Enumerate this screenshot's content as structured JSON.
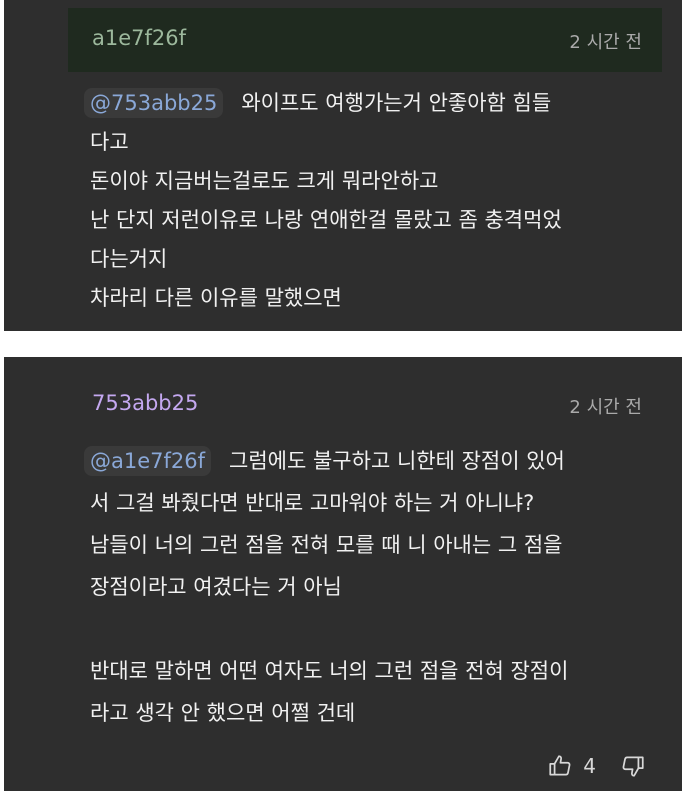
{
  "comments": [
    {
      "author": "a1e7f26f",
      "time": "2 시간 전",
      "mention": "@753abb25",
      "lines": [
        "와이프도 여행가는거 안좋아함 힘들",
        "다고",
        "돈이야 지금버는걸로도 크게 뭐라안하고",
        "난 단지 저런이유로 나랑 연애한걸 몰랐고 좀 충격먹었",
        "다는거지",
        "차라리 다른 이유를 말했으면"
      ]
    },
    {
      "author": "753abb25",
      "time": "2 시간 전",
      "mention": "@a1e7f26f",
      "lines": [
        "그럼에도 불구하고 니한테 장점이 있어",
        "서 그걸 봐줬다면 반대로 고마워야 하는 거 아니냐?",
        "남들이 너의 그런 점을 전혀 모를 때 니 아내는 그 점을",
        "장점이라고 여겼다는 거 아님",
        "",
        "반대로 말하면 어떤 여자도 너의 그런 점을 전혀 장점이",
        "라고 생각 안 했으면 어쩔 건데"
      ],
      "likes": "4"
    }
  ]
}
